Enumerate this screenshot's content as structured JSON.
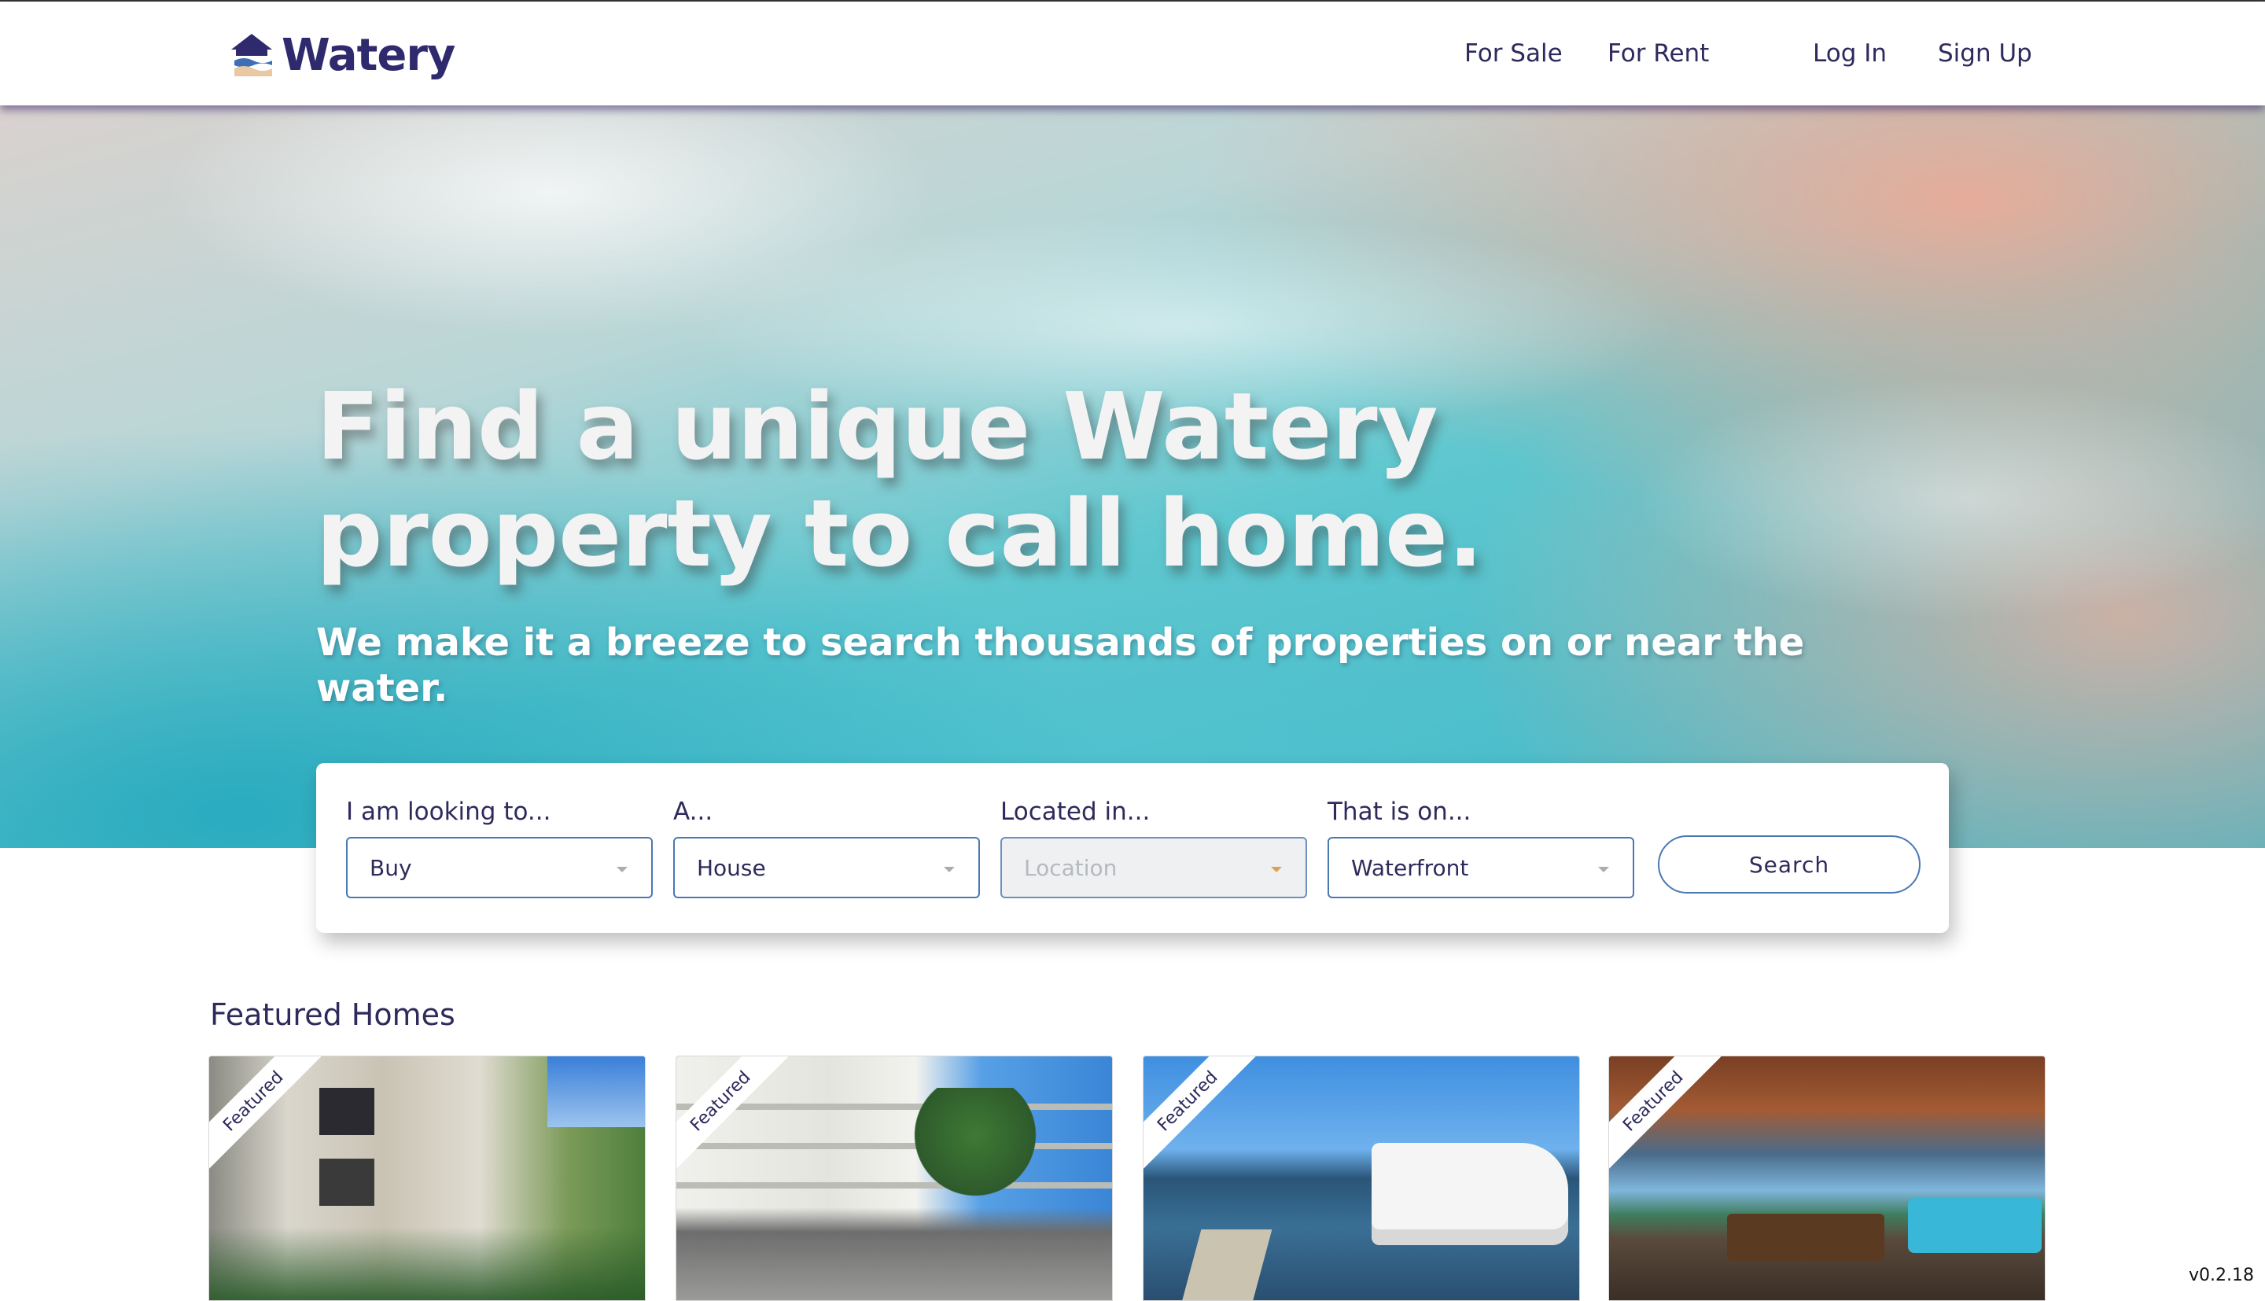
{
  "header": {
    "logo_text": "Watery",
    "nav": {
      "for_sale": "For Sale",
      "for_rent": "For Rent",
      "log_in": "Log In",
      "sign_up": "Sign Up"
    }
  },
  "hero": {
    "title": "Find a unique Watery property to call home.",
    "subtitle": "We make it a breeze to search thousands of properties on or near the water."
  },
  "search": {
    "looking_label": "I am looking to...",
    "looking_value": "Buy",
    "type_label": "A...",
    "type_value": "House",
    "location_label": "Located in...",
    "location_placeholder": "Location",
    "water_label": "That is on...",
    "water_value": "Waterfront",
    "button_label": "Search"
  },
  "featured": {
    "heading": "Featured Homes",
    "cards": [
      {
        "badge": "Featured"
      },
      {
        "badge": "Featured"
      },
      {
        "badge": "Featured"
      },
      {
        "badge": "Featured"
      }
    ]
  },
  "version": "v0.2.18",
  "colors": {
    "brand": "#2f2a6e",
    "accent_border": "#4a78b3",
    "text": "#2e2a5c"
  }
}
